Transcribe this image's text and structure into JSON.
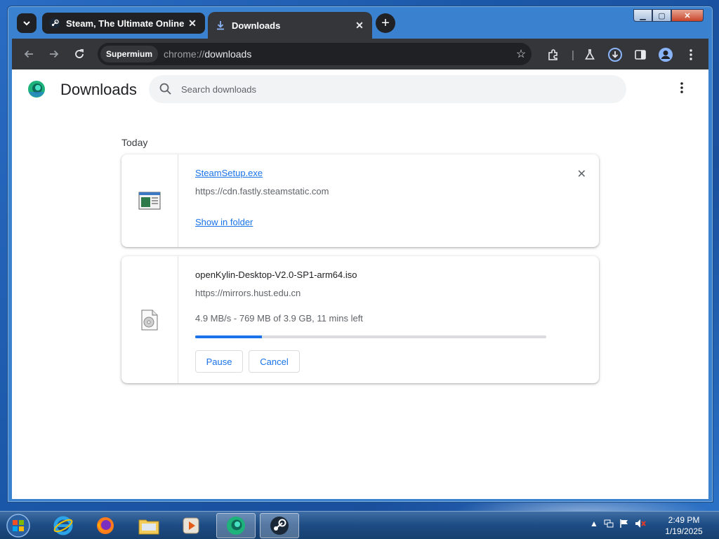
{
  "browser": {
    "tabs": [
      {
        "title": "Steam, The Ultimate Online Ga",
        "close": "✕",
        "icon": "steam-icon",
        "active": false
      },
      {
        "title": "Downloads",
        "close": "✕",
        "icon": "download-icon",
        "active": true
      }
    ],
    "new_tab": "+",
    "window_controls": {
      "minimize": "▁",
      "maximize": "▢",
      "close": "✕"
    }
  },
  "toolbar": {
    "profile_chip": "Supermium",
    "url_scheme": "chrome://",
    "url_path": "downloads"
  },
  "page": {
    "title": "Downloads",
    "search_placeholder": "Search downloads",
    "section_label": "Today"
  },
  "downloads": [
    {
      "filename": "SteamSetup.exe",
      "source": "https://cdn.fastly.steamstatic.com",
      "action_link": "Show in folder",
      "remove": "✕",
      "complete": true
    },
    {
      "filename": "openKylin-Desktop-V2.0-SP1-arm64.iso",
      "source": "https://mirrors.hust.edu.cn",
      "status": "4.9 MB/s - 769 MB of 3.9 GB, 11 mins left",
      "progress_fraction": 0.19,
      "pause_label": "Pause",
      "cancel_label": "Cancel",
      "complete": false
    }
  ],
  "taskbar": {
    "apps": [
      "internet-explorer-icon",
      "firefox-icon",
      "file-explorer-icon",
      "media-player-icon",
      "supermium-icon",
      "steam-icon"
    ],
    "time": "2:49 PM",
    "date": "1/19/2025"
  },
  "colors": {
    "accent": "#1a73e8",
    "toolbar": "#35363a",
    "tab_inactive": "#202124"
  }
}
